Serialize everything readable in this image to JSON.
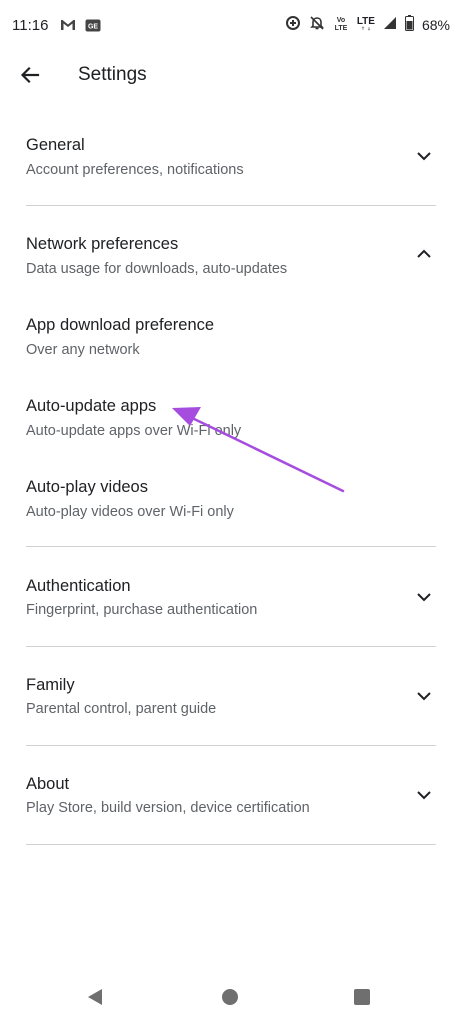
{
  "status_bar": {
    "time": "11:16",
    "lte_label": "LTE",
    "volte_label": "Vo LTE",
    "battery_percent": "68%",
    "icons": [
      "gmail-icon",
      "gallery-icon",
      "data-saver-icon",
      "notifications-off-icon",
      "volte-icon",
      "lte-icon",
      "signal-icon",
      "battery-icon"
    ]
  },
  "app_bar": {
    "title": "Settings",
    "back_icon": "arrow-back-icon"
  },
  "sections": {
    "general": {
      "title": "General",
      "subtitle": "Account preferences, notifications",
      "expanded": false
    },
    "network": {
      "title": "Network preferences",
      "subtitle": "Data usage for downloads, auto-updates",
      "expanded": true,
      "items": [
        {
          "title": "App download preference",
          "subtitle": "Over any network"
        },
        {
          "title": "Auto-update apps",
          "subtitle": "Auto-update apps over Wi-Fi only"
        },
        {
          "title": "Auto-play videos",
          "subtitle": "Auto-play videos over Wi-Fi only"
        }
      ]
    },
    "authentication": {
      "title": "Authentication",
      "subtitle": "Fingerprint, purchase authentication",
      "expanded": false
    },
    "family": {
      "title": "Family",
      "subtitle": "Parental control, parent guide",
      "expanded": false
    },
    "about": {
      "title": "About",
      "subtitle": "Play Store, build version, device certification",
      "expanded": false
    }
  },
  "annotation": {
    "color": "#a64de0"
  },
  "colors": {
    "text_primary": "#202124",
    "text_secondary": "#5f6368",
    "divider": "#cfd3d6"
  }
}
